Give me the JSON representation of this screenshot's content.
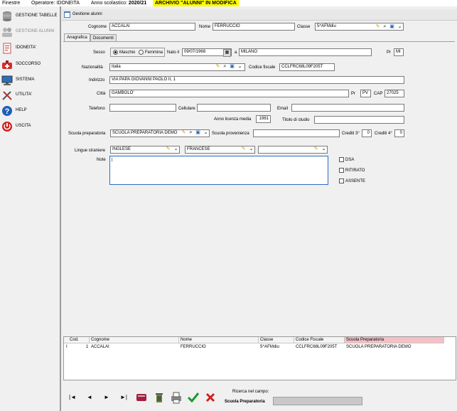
{
  "topbar": {
    "menu": "Finestre",
    "operator": "Operatore: IDONEITA",
    "year_label": "Anno scolastico: ",
    "year_value": "2020/21",
    "warning": "ARCHIVIO \"ALUNNI\" IN MODIFICA"
  },
  "sidebar": {
    "items": [
      {
        "label": "GESTIONE TABELLE",
        "icon": "database-icon"
      },
      {
        "label": "GESTIONE ALUNNI",
        "icon": "students-icon"
      },
      {
        "label": "IDONEITA'",
        "icon": "document-icon"
      },
      {
        "label": "SOCCORSO",
        "icon": "aid-icon"
      },
      {
        "label": "SISTEMA",
        "icon": "computer-icon"
      },
      {
        "label": "UTILITA'",
        "icon": "tools-icon"
      },
      {
        "label": "HELP",
        "icon": "help-icon"
      },
      {
        "label": "USCITA",
        "icon": "exit-icon"
      }
    ]
  },
  "window": {
    "title": "Gestione alunni"
  },
  "header": {
    "cognome_label": "Cognome",
    "cognome": "ACCALAI",
    "nome_label": "Nome",
    "nome": "FERRUCCIO",
    "classe_label": "Classe",
    "classe": "5^AFMdiu"
  },
  "tabs": [
    "Anagrafica",
    "Documenti"
  ],
  "form": {
    "sesso_label": "Sesso",
    "maschio": "Maschio",
    "femmina": "Femmina",
    "nato_label": "Nato il",
    "nato": "09/07/1968",
    "a_label": "a",
    "luogo": "MILANO",
    "pr_label": "Pr",
    "pr_nascita": "MI",
    "nazionalita_label": "Nazionalità",
    "nazionalita": "Italia",
    "cf_label": "Codice fiscale",
    "cf": "CCLFRC68L09F205T",
    "indirizzo_label": "Indirizzo",
    "indirizzo": "VIA PAPA GIOVANNI PAOLO II, 1",
    "citta_label": "Città",
    "citta": "GAMBOLO'",
    "pr2_label": "Pr",
    "pr_citta": "PV",
    "cap_label": "CAP",
    "cap": "27025",
    "telefono_label": "Telefono",
    "telefono": "",
    "cellulare_label": "Cellulare",
    "cellulare": "",
    "email_label": "Email",
    "email": "",
    "anno_label": "Anno licenza media",
    "anno": "1981",
    "titolo_label": "Titolo di studio",
    "titolo": "",
    "scuola_prep_label": "Scuola preparatoria",
    "scuola_prep": "SCUOLA PREPARATORIA DEMO",
    "scuola_prov_label": "Scuola provenienza",
    "scuola_prov": "",
    "crediti3_label": "Crediti 3°",
    "crediti3": "0",
    "crediti4_label": "Crediti 4°",
    "crediti4": "0",
    "lingue_label": "Lingue straniere",
    "lingua1": "INGLESE",
    "lingua2": "FRANCESE",
    "lingua3": "",
    "note_label": "Note",
    "note": "|",
    "dsa": "DSA",
    "ritirato": "RITIRATO",
    "assente": "ASSENTE"
  },
  "grid": {
    "headers": [
      "Cod.",
      "Cognome",
      "Nome",
      "Classe",
      "Codice Fiscale",
      "Scuola Preparatoria"
    ],
    "row": {
      "marker": "I",
      "cod": "1",
      "cognome": "ACCALAI",
      "nome": "FERRUCCIO",
      "classe": "5^AFMdiu",
      "cf": "CCLFRC68L09F205T",
      "scuola": "SCUOLA PREPARATORIA DEMO"
    }
  },
  "bottom": {
    "search_label": "Ricerca nel campo:",
    "search_field": "Scuola Preparatoria",
    "nav": [
      "|◄",
      "◄",
      "►",
      "►|"
    ]
  }
}
